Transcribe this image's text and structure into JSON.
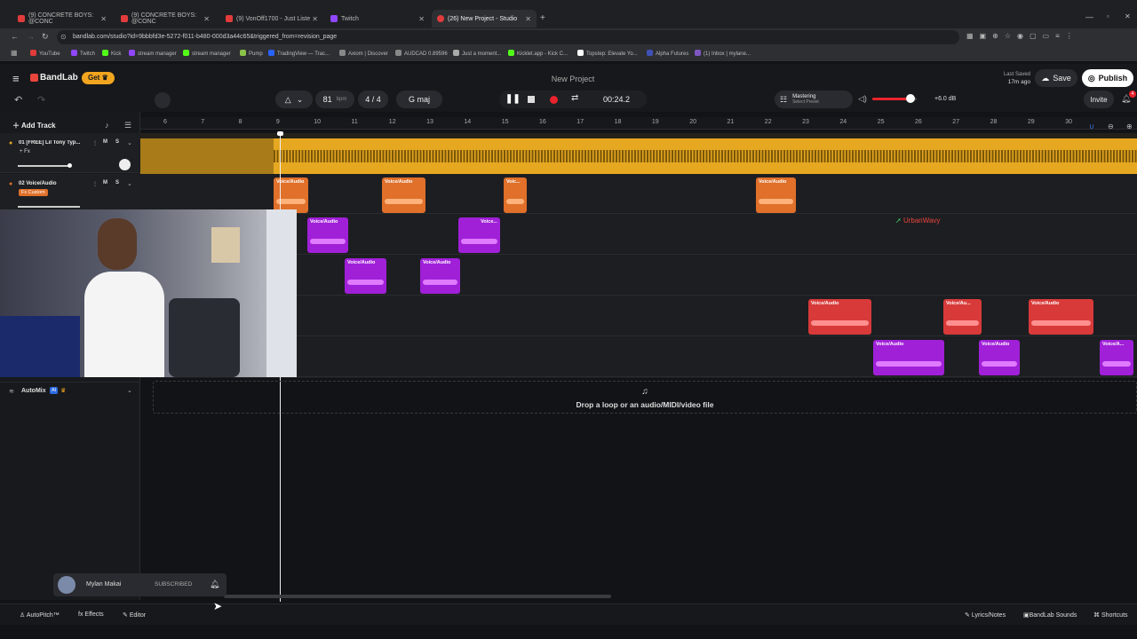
{
  "browser": {
    "tabs": [
      {
        "title": "(9) CONCRETE BOYS: @CONC",
        "color": "#e23b3b"
      },
      {
        "title": "(9) CONCRETE BOYS: @CONC",
        "color": "#e23b3b"
      },
      {
        "title": "(9) VonOff1700 - Just Liste",
        "color": "#e23b3b"
      },
      {
        "title": "Twitch",
        "color": "#9146ff"
      },
      {
        "title": "(26) New Project - Studio",
        "color": "#e23b3b"
      }
    ],
    "url": "bandlab.com/studio?id=9bbbfd3e-5272-f011-b480-000d3a44c65&triggered_from=revision_page",
    "bookmarks": [
      {
        "label": "YouTube",
        "color": "#e23b3b"
      },
      {
        "label": "Twitch",
        "color": "#9146ff"
      },
      {
        "label": "Kick",
        "color": "#53fc18"
      },
      {
        "label": "stream manager",
        "color": "#9146ff"
      },
      {
        "label": "stream manager",
        "color": "#53fc18"
      },
      {
        "label": "Pump",
        "color": "#8bc34a"
      },
      {
        "label": "TradingView — Trac...",
        "color": "#2962ff"
      },
      {
        "label": "Axiom | Discover",
        "color": "#888888"
      },
      {
        "label": "AUDCAD 0.89596",
        "color": "#888888"
      },
      {
        "label": "Just a moment...",
        "color": "#aaaaaa"
      },
      {
        "label": "Kicklet.app - Kick C...",
        "color": "#53fc18"
      },
      {
        "label": "Topstep: Elevate Yo...",
        "color": "#ffffff"
      },
      {
        "label": "Alpha Futures",
        "color": "#3f51b5"
      },
      {
        "label": "(1) Inbox | mylane...",
        "color": "#7e57c2"
      }
    ]
  },
  "app": {
    "brand": "BandLab",
    "get": "Get",
    "project_title": "New Project",
    "last_saved": "Last Saved",
    "last_saved_time": "17m ago",
    "save": "Save",
    "publish": "Publish",
    "invite": "Invite",
    "notif_count": "4",
    "bpm": "81",
    "bpm_unit": "bpm",
    "time_sig_top": "4",
    "time_sig_bottom": "4",
    "key": "G maj",
    "time": "00:24.2",
    "mastering": "Mastering",
    "select_preset": "Select Preset",
    "volume_db": "+6.0 dB",
    "volume_level": 0.85,
    "add_track": "Add Track"
  },
  "ruler": [
    "6",
    "7",
    "8",
    "9",
    "10",
    "11",
    "12",
    "13",
    "14",
    "15",
    "16",
    "17",
    "18",
    "19",
    "20",
    "21",
    "22",
    "23",
    "24",
    "25",
    "26",
    "27",
    "28",
    "29",
    "30"
  ],
  "tracks": [
    {
      "name": "01 [FREE] Lil Tony Typ...",
      "fx": "+ Fx"
    },
    {
      "name": "02 Voice/Audio",
      "fx": "Fx Custom"
    }
  ],
  "automix": {
    "label": "AutoMix",
    "badge": "AI"
  },
  "clips": {
    "label": "Voice/Audio",
    "short1": "Voic...",
    "short2": "Voice...",
    "short3": "Voice/Au...",
    "short4": "Voice/A..."
  },
  "collab": "UrbanWavy",
  "drop_text": "Drop a loop or an audio/MIDI/video file",
  "subscribe": {
    "name": "Mylan Makai",
    "status": "SUBSCRIBED"
  },
  "footer": {
    "autopitch": "AutoPitch™",
    "effects": "Effects",
    "editor": "Editor",
    "lyrics": "Lyrics/Notes",
    "sounds": "BandLab Sounds",
    "shortcuts": "Shortcuts"
  },
  "colors": {
    "accent": "#e8453c",
    "beat": "#e6a821",
    "orange": "#e0702a",
    "purple": "#a020d8",
    "red": "#d83a3a"
  }
}
